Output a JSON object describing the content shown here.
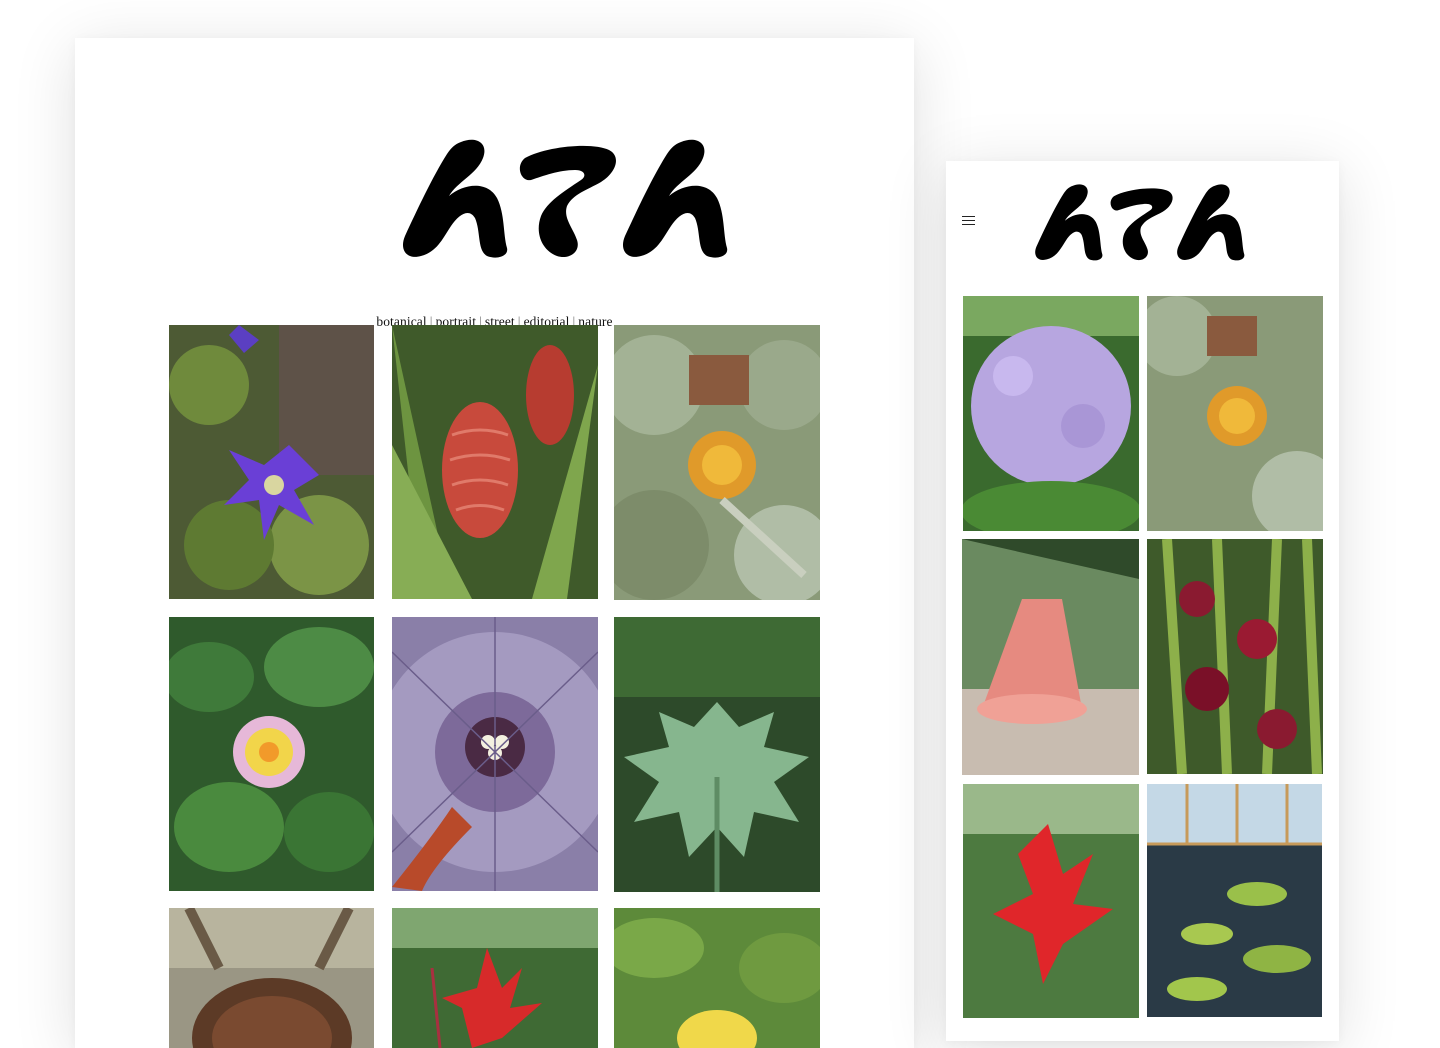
{
  "site": {
    "logo_text": "hTh"
  },
  "desktop": {
    "categories": [
      "botanical",
      "portrait",
      "street",
      "editorial",
      "nature"
    ],
    "separator": "|",
    "photos": [
      {
        "subject": "purple clematis flower"
      },
      {
        "subject": "red beehive ginger"
      },
      {
        "subject": "orange pincushion protea"
      },
      {
        "subject": "yellow pink lantana"
      },
      {
        "subject": "purple flower macro"
      },
      {
        "subject": "large green leaf"
      },
      {
        "subject": "brown seed pod"
      },
      {
        "subject": "red canna flower"
      },
      {
        "subject": "yellow flower in foliage"
      }
    ]
  },
  "mobile": {
    "menu_icon": "hamburger-icon",
    "photos": [
      {
        "subject": "lilac rhododendron bush"
      },
      {
        "subject": "orange pincushion protea"
      },
      {
        "subject": "pink angel trumpet"
      },
      {
        "subject": "red torch ginger"
      },
      {
        "subject": "red canna flower"
      },
      {
        "subject": "water lily greenhouse"
      }
    ]
  },
  "colors": {
    "background": "#ffffff",
    "text": "#111111",
    "logo": "#000000"
  }
}
